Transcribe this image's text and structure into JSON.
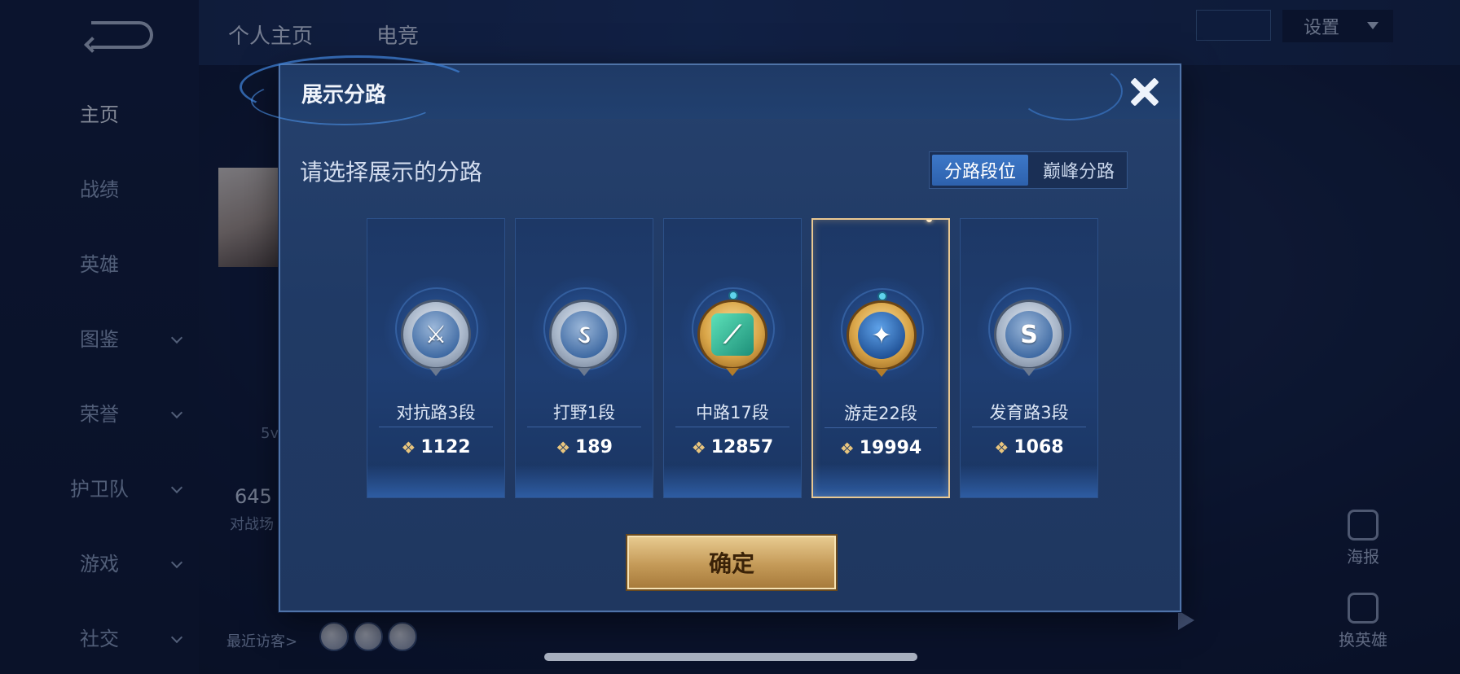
{
  "background": {
    "sidebar": [
      {
        "label": "主页",
        "active": true,
        "chevron": false
      },
      {
        "label": "战绩",
        "active": false,
        "chevron": false
      },
      {
        "label": "英雄",
        "active": false,
        "chevron": false
      },
      {
        "label": "图鉴",
        "active": false,
        "chevron": true
      },
      {
        "label": "荣誉",
        "active": false,
        "chevron": true
      },
      {
        "label": "护卫队",
        "active": false,
        "chevron": true
      },
      {
        "label": "游戏",
        "active": false,
        "chevron": true
      },
      {
        "label": "社交",
        "active": false,
        "chevron": true
      }
    ],
    "top_tabs": [
      "个人主页",
      "电竞"
    ],
    "settings_label": "设置",
    "stat_partial": "645",
    "stat_label_partial": "对战场",
    "mode_partial": "5v",
    "recent_visitors_label": "最近访客>",
    "right_buttons": [
      "海报",
      "换英雄"
    ]
  },
  "modal": {
    "title": "展示分路",
    "subtitle": "请选择展示的分路",
    "toggle": {
      "options": [
        "分路段位",
        "巅峰分路"
      ],
      "active_index": 0
    },
    "cards": [
      {
        "title": "对抗路3段",
        "score": "1122",
        "badge": "silver",
        "icon": "crossed-swords-icon",
        "glyph": "⚔",
        "selected": false
      },
      {
        "title": "打野1段",
        "score": "189",
        "badge": "silver",
        "icon": "dragon-icon",
        "glyph": "🐉",
        "selected": false
      },
      {
        "title": "中路17段",
        "score": "12857",
        "badge": "gold",
        "icon": "mid-lane-icon",
        "glyph": "⟋",
        "selected": false
      },
      {
        "title": "游走22段",
        "score": "19994",
        "badge": "gold",
        "icon": "winged-roam-icon",
        "glyph": "✦",
        "selected": true
      },
      {
        "title": "发育路3段",
        "score": "1068",
        "badge": "silver",
        "icon": "bottom-lane-icon",
        "glyph": "S",
        "selected": false
      }
    ],
    "confirm_label": "确定"
  }
}
